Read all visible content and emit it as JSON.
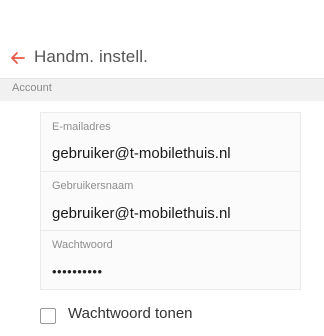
{
  "header": {
    "title": "Handm. instell.",
    "back_icon": "arrow-left-icon",
    "accent_color": "#e8594a"
  },
  "section": {
    "label": "Account"
  },
  "fields": [
    {
      "label": "E-mailadres",
      "value": "gebruiker@t-mobilethuis.nl"
    },
    {
      "label": "Gebruikersnaam",
      "value": "gebruiker@t-mobilethuis.nl"
    },
    {
      "label": "Wachtwoord",
      "value": "••••••••••"
    }
  ],
  "show_password": {
    "label": "Wachtwoord tonen",
    "checked": false
  }
}
